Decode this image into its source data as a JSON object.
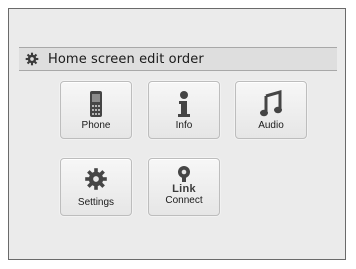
{
  "title": "Home screen edit order",
  "tiles": [
    {
      "label": "Phone",
      "icon": "phone-icon"
    },
    {
      "label": "Info",
      "icon": "info-icon"
    },
    {
      "label": "Audio",
      "icon": "music-note-icon"
    },
    {
      "label": "Settings",
      "icon": "gear-icon"
    },
    {
      "label": "Connect",
      "icon": "link-icon",
      "wordmark": "Link"
    }
  ]
}
